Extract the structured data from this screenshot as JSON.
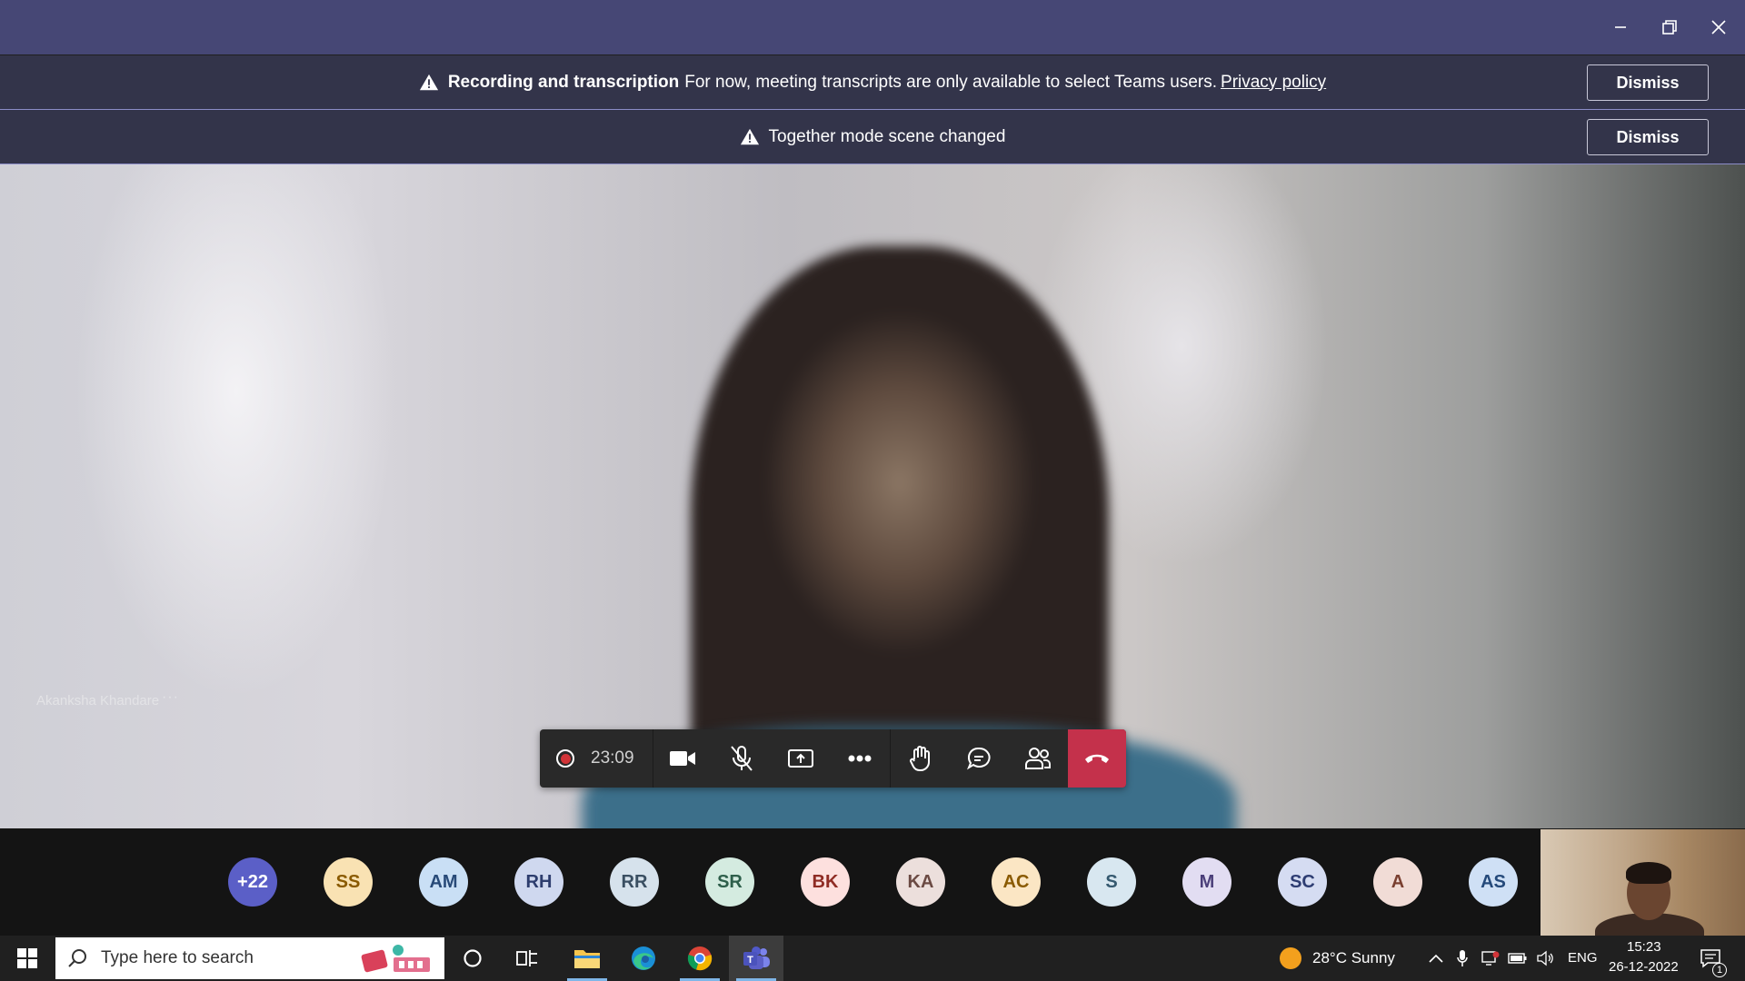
{
  "banners": [
    {
      "bold": "Recording and transcription",
      "text": "For now, meeting transcripts are only available to select Teams users.",
      "link": "Privacy policy",
      "button": "Dismiss"
    },
    {
      "text": "Together mode scene changed",
      "button": "Dismiss"
    }
  ],
  "video": {
    "participant_name": "Akanksha Khandare",
    "more_label": "···"
  },
  "controls": {
    "timer": "23:09"
  },
  "participants": [
    {
      "initials": "+22",
      "bg": "#5b5fc7",
      "fg": "#ffffff"
    },
    {
      "initials": "SS",
      "bg": "#f9e2b3",
      "fg": "#8a5a00"
    },
    {
      "initials": "AM",
      "bg": "#c9dff5",
      "fg": "#284a78"
    },
    {
      "initials": "RH",
      "bg": "#cfd8ef",
      "fg": "#2d3d6e"
    },
    {
      "initials": "RR",
      "bg": "#d6e2ec",
      "fg": "#3a4f62"
    },
    {
      "initials": "SR",
      "bg": "#d4ebe0",
      "fg": "#2e5f4b"
    },
    {
      "initials": "BK",
      "bg": "#fde0de",
      "fg": "#8f2c24"
    },
    {
      "initials": "KA",
      "bg": "#ecdfdc",
      "fg": "#6b4a43"
    },
    {
      "initials": "AC",
      "bg": "#fbe6c4",
      "fg": "#8a5a00"
    },
    {
      "initials": "S",
      "bg": "#d8e7f0",
      "fg": "#35596f"
    },
    {
      "initials": "M",
      "bg": "#e2ddf2",
      "fg": "#4b3f7a"
    },
    {
      "initials": "SC",
      "bg": "#d5dcf2",
      "fg": "#2e3d73"
    },
    {
      "initials": "A",
      "bg": "#f1dcd6",
      "fg": "#7a3f30"
    },
    {
      "initials": "AS",
      "bg": "#cfe0f5",
      "fg": "#24497a"
    }
  ],
  "taskbar": {
    "search_placeholder": "Type here to search",
    "weather": "28°C  Sunny",
    "language": "ENG",
    "time": "15:23",
    "date": "26-12-2022",
    "notification_count": "1"
  }
}
